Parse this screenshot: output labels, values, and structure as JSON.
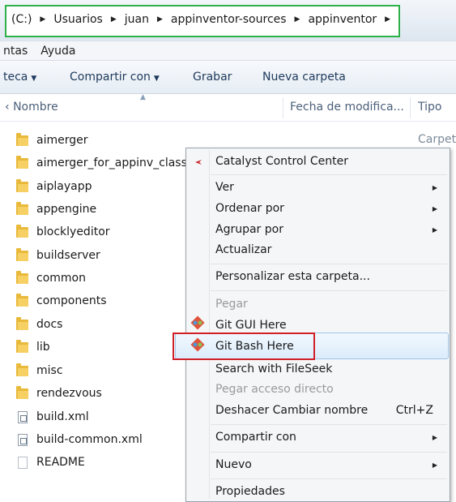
{
  "address_bar": {
    "crumbs": [
      "(C:)",
      "Usuarios",
      "juan",
      "appinventor-sources",
      "appinventor"
    ]
  },
  "menubar": {
    "items": [
      "ntas",
      "Ayuda"
    ]
  },
  "toolbar": {
    "library_label": "teca",
    "share_label": "Compartir con",
    "burn_label": "Grabar",
    "new_folder_label": "Nueva carpeta"
  },
  "columns": {
    "name": "Nombre",
    "modified": "Fecha de modifica...",
    "type": "Tipo"
  },
  "files": [
    {
      "name": "aimerger",
      "kind": "folder"
    },
    {
      "name": "aimerger_for_appinv_class",
      "kind": "folder"
    },
    {
      "name": "aiplayapp",
      "kind": "folder"
    },
    {
      "name": "appengine",
      "kind": "folder"
    },
    {
      "name": "blocklyeditor",
      "kind": "folder"
    },
    {
      "name": "buildserver",
      "kind": "folder"
    },
    {
      "name": "common",
      "kind": "folder"
    },
    {
      "name": "components",
      "kind": "folder"
    },
    {
      "name": "docs",
      "kind": "folder"
    },
    {
      "name": "lib",
      "kind": "folder"
    },
    {
      "name": "misc",
      "kind": "folder"
    },
    {
      "name": "rendezvous",
      "kind": "folder"
    },
    {
      "name": "build.xml",
      "kind": "xml"
    },
    {
      "name": "build-common.xml",
      "kind": "xml"
    },
    {
      "name": "README",
      "kind": "file"
    }
  ],
  "first_row_type": "Carpet",
  "context_menu": {
    "catalyst": "Catalyst Control Center",
    "ver": "Ver",
    "ordenar": "Ordenar por",
    "agrupar": "Agrupar por",
    "actualizar": "Actualizar",
    "personalizar": "Personalizar esta carpeta...",
    "pegar": "Pegar",
    "git_gui": "Git GUI Here",
    "git_bash": "Git Bash Here",
    "fileseek": "Search with FileSeek",
    "pegar_acceso": "Pegar acceso directo",
    "deshacer": "Deshacer Cambiar nombre",
    "deshacer_shortcut": "Ctrl+Z",
    "compartir": "Compartir con",
    "nuevo": "Nuevo",
    "propiedades": "Propiedades"
  },
  "colors": {
    "address_highlight": "#2db24a",
    "menu_highlight_box": "#d01f26",
    "folder": "#e8b93a"
  }
}
